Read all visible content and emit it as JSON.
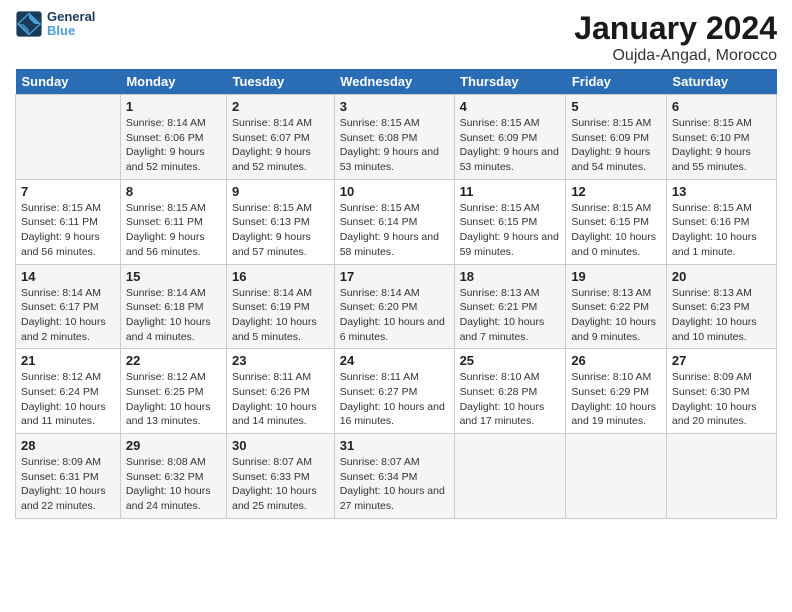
{
  "header": {
    "logo_text_general": "General",
    "logo_text_blue": "Blue",
    "title": "January 2024",
    "subtitle": "Oujda-Angad, Morocco"
  },
  "calendar": {
    "days_of_week": [
      "Sunday",
      "Monday",
      "Tuesday",
      "Wednesday",
      "Thursday",
      "Friday",
      "Saturday"
    ],
    "weeks": [
      [
        {
          "day": "",
          "sunrise": "",
          "sunset": "",
          "daylight": ""
        },
        {
          "day": "1",
          "sunrise": "Sunrise: 8:14 AM",
          "sunset": "Sunset: 6:06 PM",
          "daylight": "Daylight: 9 hours and 52 minutes."
        },
        {
          "day": "2",
          "sunrise": "Sunrise: 8:14 AM",
          "sunset": "Sunset: 6:07 PM",
          "daylight": "Daylight: 9 hours and 52 minutes."
        },
        {
          "day": "3",
          "sunrise": "Sunrise: 8:15 AM",
          "sunset": "Sunset: 6:08 PM",
          "daylight": "Daylight: 9 hours and 53 minutes."
        },
        {
          "day": "4",
          "sunrise": "Sunrise: 8:15 AM",
          "sunset": "Sunset: 6:09 PM",
          "daylight": "Daylight: 9 hours and 53 minutes."
        },
        {
          "day": "5",
          "sunrise": "Sunrise: 8:15 AM",
          "sunset": "Sunset: 6:09 PM",
          "daylight": "Daylight: 9 hours and 54 minutes."
        },
        {
          "day": "6",
          "sunrise": "Sunrise: 8:15 AM",
          "sunset": "Sunset: 6:10 PM",
          "daylight": "Daylight: 9 hours and 55 minutes."
        }
      ],
      [
        {
          "day": "7",
          "sunrise": "Sunrise: 8:15 AM",
          "sunset": "Sunset: 6:11 PM",
          "daylight": "Daylight: 9 hours and 56 minutes."
        },
        {
          "day": "8",
          "sunrise": "Sunrise: 8:15 AM",
          "sunset": "Sunset: 6:11 PM",
          "daylight": "Daylight: 9 hours and 56 minutes."
        },
        {
          "day": "9",
          "sunrise": "Sunrise: 8:15 AM",
          "sunset": "Sunset: 6:13 PM",
          "daylight": "Daylight: 9 hours and 57 minutes."
        },
        {
          "day": "10",
          "sunrise": "Sunrise: 8:15 AM",
          "sunset": "Sunset: 6:14 PM",
          "daylight": "Daylight: 9 hours and 58 minutes."
        },
        {
          "day": "11",
          "sunrise": "Sunrise: 8:15 AM",
          "sunset": "Sunset: 6:15 PM",
          "daylight": "Daylight: 9 hours and 59 minutes."
        },
        {
          "day": "12",
          "sunrise": "Sunrise: 8:15 AM",
          "sunset": "Sunset: 6:15 PM",
          "daylight": "Daylight: 10 hours and 0 minutes."
        },
        {
          "day": "13",
          "sunrise": "Sunrise: 8:15 AM",
          "sunset": "Sunset: 6:16 PM",
          "daylight": "Daylight: 10 hours and 1 minute."
        }
      ],
      [
        {
          "day": "14",
          "sunrise": "Sunrise: 8:14 AM",
          "sunset": "Sunset: 6:17 PM",
          "daylight": "Daylight: 10 hours and 2 minutes."
        },
        {
          "day": "15",
          "sunrise": "Sunrise: 8:14 AM",
          "sunset": "Sunset: 6:18 PM",
          "daylight": "Daylight: 10 hours and 4 minutes."
        },
        {
          "day": "16",
          "sunrise": "Sunrise: 8:14 AM",
          "sunset": "Sunset: 6:19 PM",
          "daylight": "Daylight: 10 hours and 5 minutes."
        },
        {
          "day": "17",
          "sunrise": "Sunrise: 8:14 AM",
          "sunset": "Sunset: 6:20 PM",
          "daylight": "Daylight: 10 hours and 6 minutes."
        },
        {
          "day": "18",
          "sunrise": "Sunrise: 8:13 AM",
          "sunset": "Sunset: 6:21 PM",
          "daylight": "Daylight: 10 hours and 7 minutes."
        },
        {
          "day": "19",
          "sunrise": "Sunrise: 8:13 AM",
          "sunset": "Sunset: 6:22 PM",
          "daylight": "Daylight: 10 hours and 9 minutes."
        },
        {
          "day": "20",
          "sunrise": "Sunrise: 8:13 AM",
          "sunset": "Sunset: 6:23 PM",
          "daylight": "Daylight: 10 hours and 10 minutes."
        }
      ],
      [
        {
          "day": "21",
          "sunrise": "Sunrise: 8:12 AM",
          "sunset": "Sunset: 6:24 PM",
          "daylight": "Daylight: 10 hours and 11 minutes."
        },
        {
          "day": "22",
          "sunrise": "Sunrise: 8:12 AM",
          "sunset": "Sunset: 6:25 PM",
          "daylight": "Daylight: 10 hours and 13 minutes."
        },
        {
          "day": "23",
          "sunrise": "Sunrise: 8:11 AM",
          "sunset": "Sunset: 6:26 PM",
          "daylight": "Daylight: 10 hours and 14 minutes."
        },
        {
          "day": "24",
          "sunrise": "Sunrise: 8:11 AM",
          "sunset": "Sunset: 6:27 PM",
          "daylight": "Daylight: 10 hours and 16 minutes."
        },
        {
          "day": "25",
          "sunrise": "Sunrise: 8:10 AM",
          "sunset": "Sunset: 6:28 PM",
          "daylight": "Daylight: 10 hours and 17 minutes."
        },
        {
          "day": "26",
          "sunrise": "Sunrise: 8:10 AM",
          "sunset": "Sunset: 6:29 PM",
          "daylight": "Daylight: 10 hours and 19 minutes."
        },
        {
          "day": "27",
          "sunrise": "Sunrise: 8:09 AM",
          "sunset": "Sunset: 6:30 PM",
          "daylight": "Daylight: 10 hours and 20 minutes."
        }
      ],
      [
        {
          "day": "28",
          "sunrise": "Sunrise: 8:09 AM",
          "sunset": "Sunset: 6:31 PM",
          "daylight": "Daylight: 10 hours and 22 minutes."
        },
        {
          "day": "29",
          "sunrise": "Sunrise: 8:08 AM",
          "sunset": "Sunset: 6:32 PM",
          "daylight": "Daylight: 10 hours and 24 minutes."
        },
        {
          "day": "30",
          "sunrise": "Sunrise: 8:07 AM",
          "sunset": "Sunset: 6:33 PM",
          "daylight": "Daylight: 10 hours and 25 minutes."
        },
        {
          "day": "31",
          "sunrise": "Sunrise: 8:07 AM",
          "sunset": "Sunset: 6:34 PM",
          "daylight": "Daylight: 10 hours and 27 minutes."
        },
        {
          "day": "",
          "sunrise": "",
          "sunset": "",
          "daylight": ""
        },
        {
          "day": "",
          "sunrise": "",
          "sunset": "",
          "daylight": ""
        },
        {
          "day": "",
          "sunrise": "",
          "sunset": "",
          "daylight": ""
        }
      ]
    ]
  }
}
